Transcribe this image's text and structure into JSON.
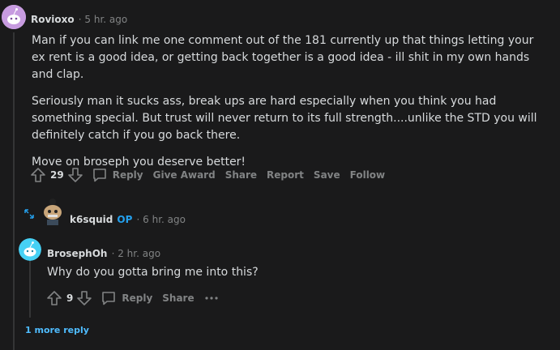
{
  "comment1": {
    "username": "Rovioxo",
    "time": "5 hr. ago",
    "paragraphs": [
      "Man if you can link me one comment out of the 181 currently up that things letting your ex rent is a good idea, or getting back together is a good idea - ill shit in my own hands and clap.",
      "Seriously man it sucks ass, break ups are hard especially when you think you had something special. But trust will never return to its full strength....unlike the STD you will definitely catch if you go back there.",
      "Move on broseph you deserve better!"
    ],
    "votes": "29",
    "actions": [
      "Reply",
      "Give Award",
      "Share",
      "Report",
      "Save",
      "Follow"
    ]
  },
  "collapsed_reply": {
    "username": "k6squid",
    "badge": "OP",
    "time": "6 hr. ago"
  },
  "comment2": {
    "username": "BrosephOh",
    "time": "2 hr. ago",
    "text": "Why do you gotta bring me into this?",
    "votes": "9",
    "actions": [
      "Reply",
      "Share"
    ],
    "more_icon": "ellipsis-icon"
  },
  "more_replies": "1 more reply",
  "colors": {
    "background": "#1a1a1b",
    "text": "#d7dadc",
    "muted": "#818384",
    "op": "#24a0ed",
    "link": "#4fbcff"
  }
}
